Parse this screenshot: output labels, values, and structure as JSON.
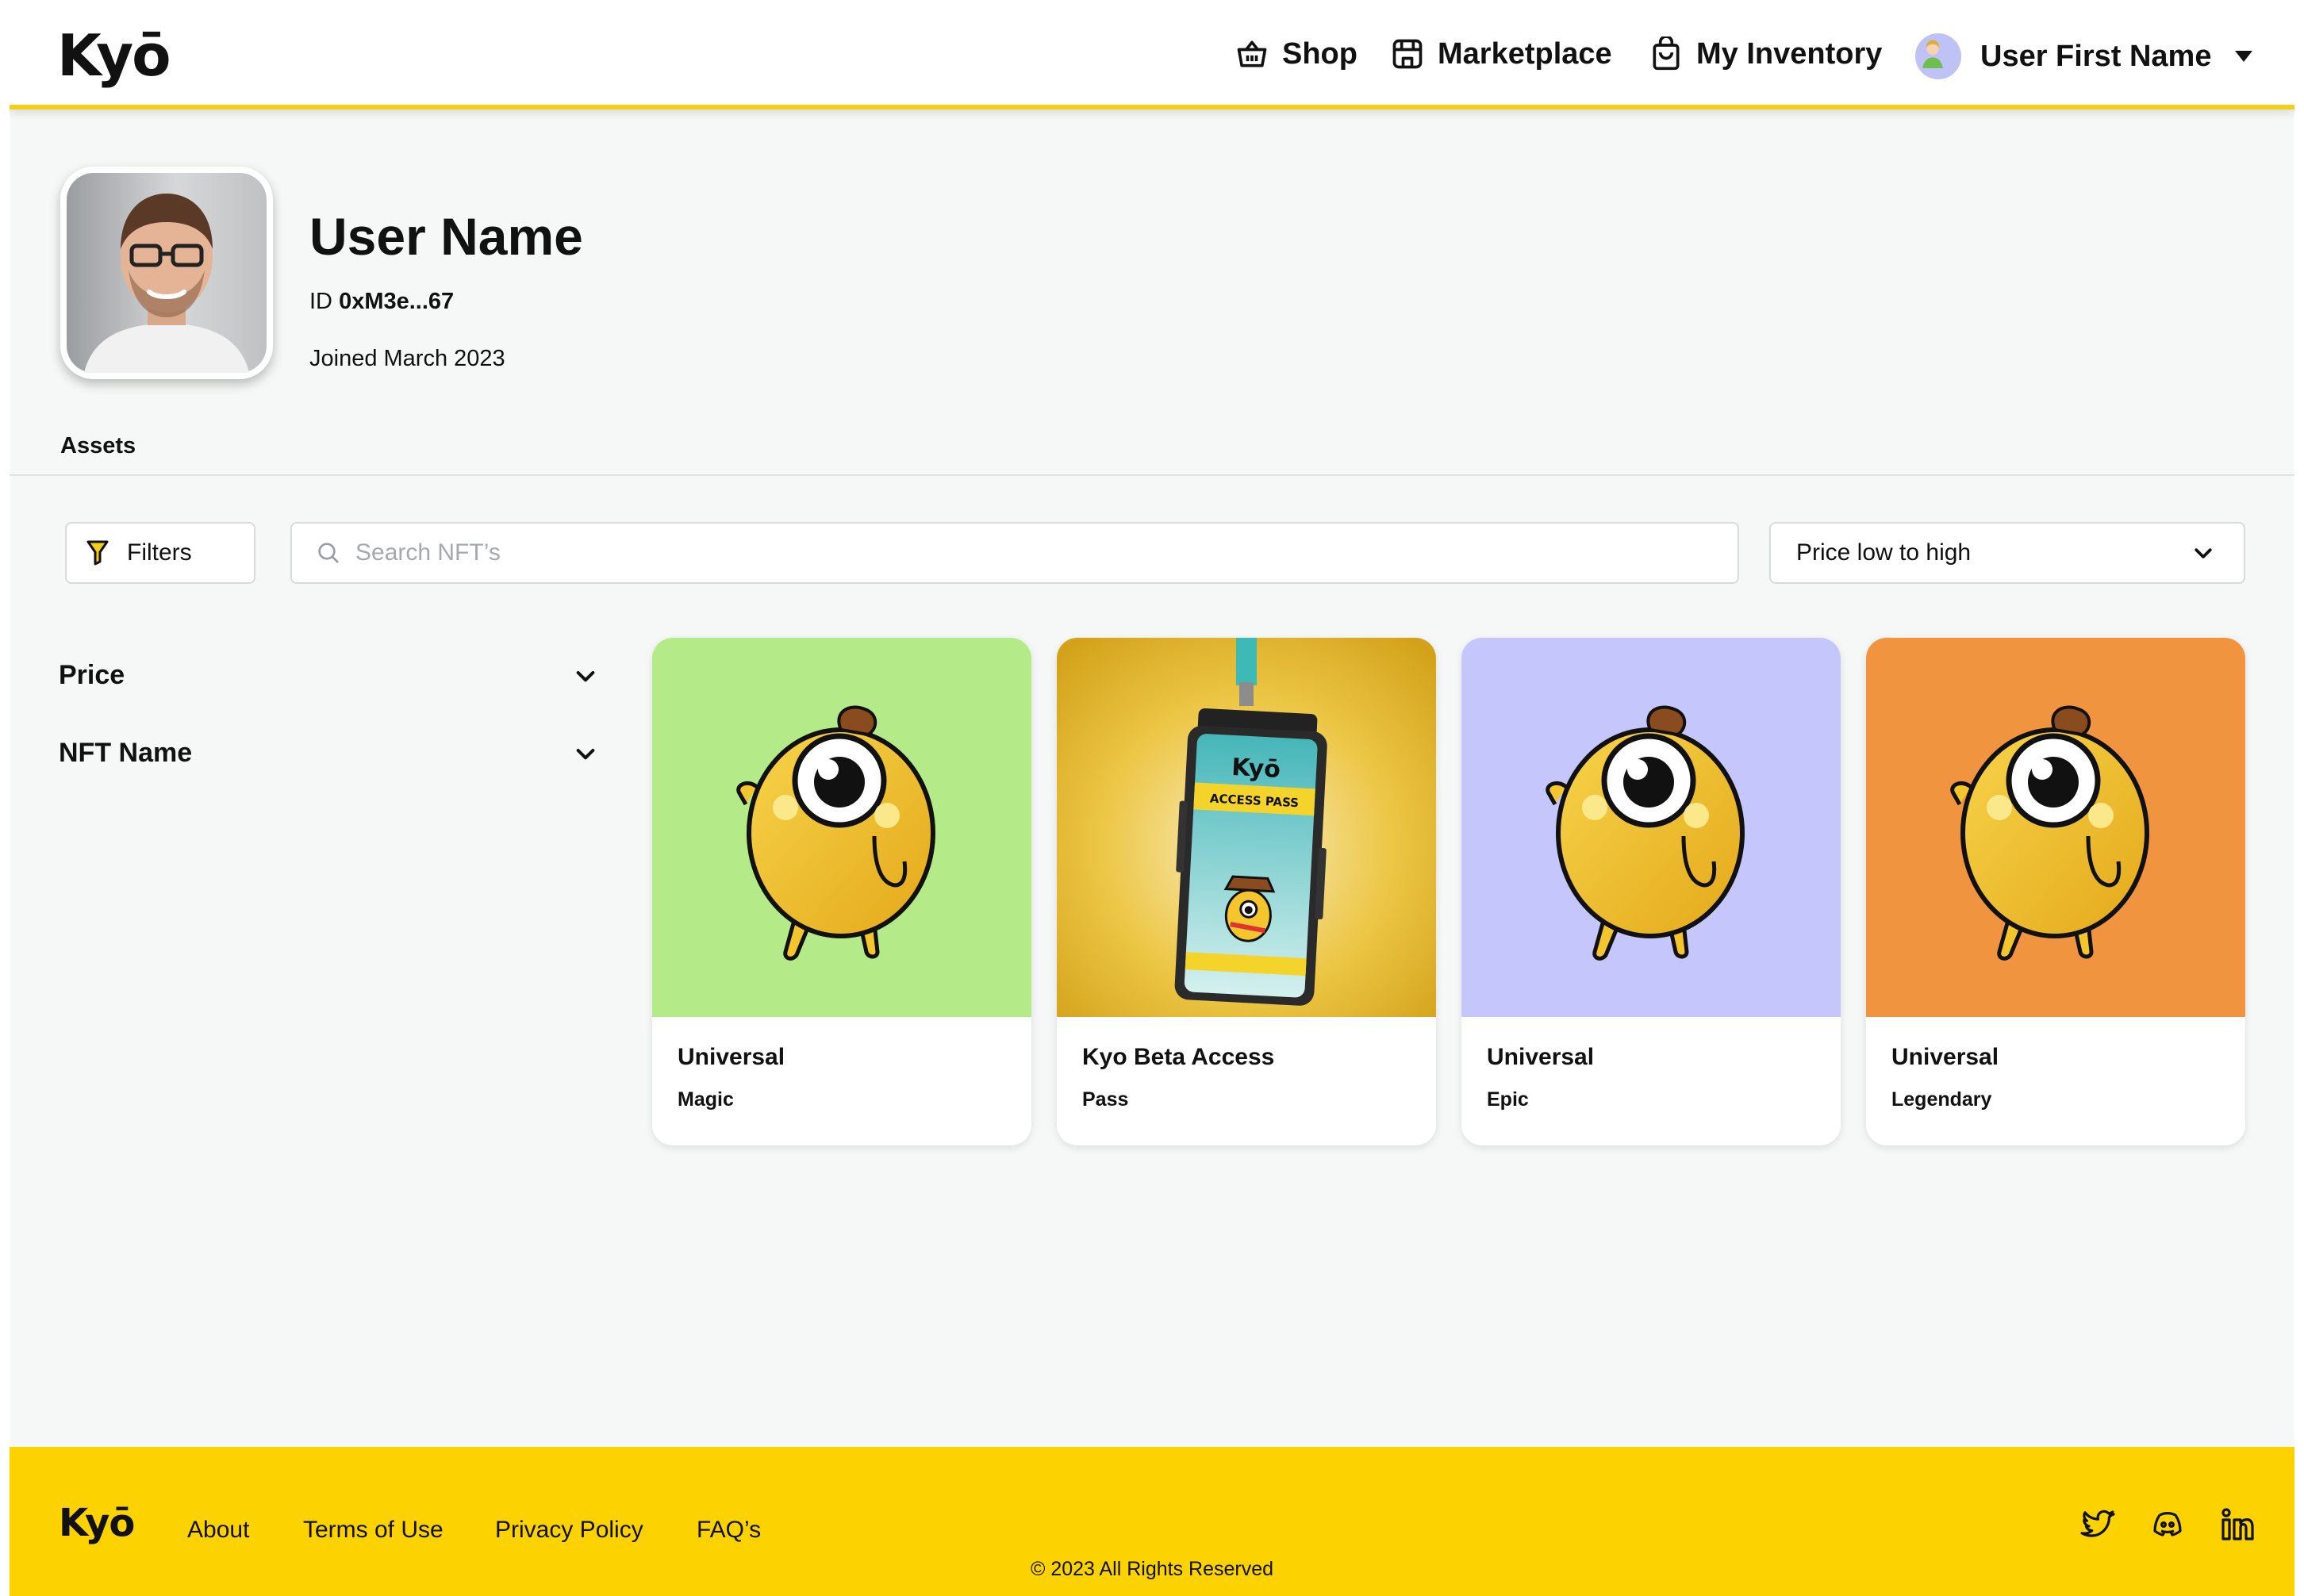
{
  "brand": {
    "logo": "Kyō",
    "accent_color": "#f4cf1a",
    "footer_color": "#fdd201"
  },
  "nav": {
    "shop": "Shop",
    "marketplace": "Marketplace",
    "inventory": "My Inventory",
    "user": "User First Name",
    "icons": [
      "basket-icon",
      "storefront-icon",
      "shopping-bag-icon",
      "user-avatar",
      "caret-down-icon"
    ]
  },
  "profile": {
    "name": "User Name",
    "id_label": "ID",
    "id_value": "0xM3e...67",
    "joined": "Joined March 2023"
  },
  "tabs": {
    "assets": "Assets"
  },
  "controls": {
    "filters_label": "Filters",
    "search_placeholder": "Search NFT’s",
    "sort_label": "Price low to high"
  },
  "facets": [
    "Price",
    "NFT Name"
  ],
  "cards": [
    {
      "title": "Universal",
      "subtitle": "Magic",
      "bg": "#b4eb88"
    },
    {
      "title": "Kyo Beta Access",
      "subtitle": "Pass",
      "bg": "#e7bd2a"
    },
    {
      "title": "Universal",
      "subtitle": "Epic",
      "bg": "#c5c6fb"
    },
    {
      "title": "Universal",
      "subtitle": "Legendary",
      "bg": "#f19440"
    }
  ],
  "pass": {
    "logo": "Kyō",
    "text": "ACCESS PASS"
  },
  "footer": {
    "logo": "Kyō",
    "links": [
      "About",
      "Terms of Use",
      "Privacy Policy",
      "FAQ’s"
    ],
    "copyright": "© 2023 All Rights Reserved",
    "social_icons": [
      "twitter-icon",
      "discord-icon",
      "linkedin-icon"
    ]
  }
}
